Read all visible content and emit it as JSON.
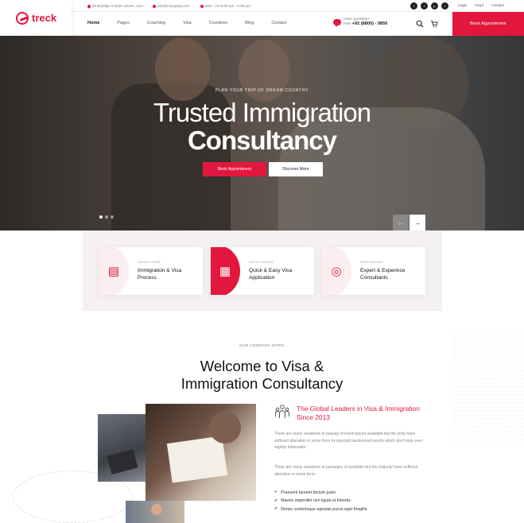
{
  "topbar": {
    "address": "30 Booklyn Golden Street, USA",
    "email": "info@company.com",
    "hours": "Mon - Fri 8.00 am - 6.00 pm",
    "socials": [
      "twitter-icon",
      "facebook-icon",
      "pinterest-icon",
      "instagram-icon"
    ],
    "social_glyphs": [
      "t",
      "f",
      "p",
      "i"
    ],
    "links": [
      "Login",
      "Faq's",
      "Contact"
    ]
  },
  "brand": {
    "name": "treck",
    "color": "#e3173e"
  },
  "nav": [
    "Home",
    "Pages",
    "Coaching",
    "Visa",
    "Countries",
    "Blog",
    "Contact"
  ],
  "header_contact": {
    "question": "Have Question?",
    "prefix": "Free",
    "phone": "+92 (8800) - 9850"
  },
  "header_book": "Book Appointment",
  "hero": {
    "kicker": "PLAN YOUR TRIP OF DREAM COUNTRY",
    "title_line1": "Trusted Immigration",
    "title_line2": "Consultancy",
    "btn_primary": "Book Appointment",
    "btn_secondary": "Discover More",
    "slides": 3,
    "active_slide": 1,
    "prev_arrow": "←",
    "next_arrow": "→"
  },
  "features": [
    {
      "sub": "TAKING CARE",
      "title": "Immigration & Visa Process",
      "icon": "passport-icon",
      "glyph": "▤"
    },
    {
      "sub": "APPLY ONLINE",
      "title": "Quick & Easy Visa Application",
      "icon": "document-icon",
      "glyph": "▦"
    },
    {
      "sub": "FREE ADVICE",
      "title": "Expert & Experince Consultants",
      "icon": "globe-icon",
      "glyph": "◎"
    }
  ],
  "intro": {
    "kicker": "OUR COMPANY INTRO",
    "title_line1": "Welcome to Visa &",
    "title_line2": "Immigration Consultancy"
  },
  "about": {
    "lead_line1": "The Global Leaders in Visa & Immigration",
    "lead_line2": "Since 2013",
    "p1": "There are many variations of passag of lorem ipsum available but the jority have suffered alteration in some form by injected randomised words which don't look even slightly believable.",
    "p2": "There are many variations of passages of available but the majority have suffered alteration in some form.",
    "list": [
      "Praesent laoreet dictum justo.",
      "Mauris imperdiet non ligula et lobortis.",
      "Donec scelerisque egestas purus eget fringilla"
    ]
  }
}
